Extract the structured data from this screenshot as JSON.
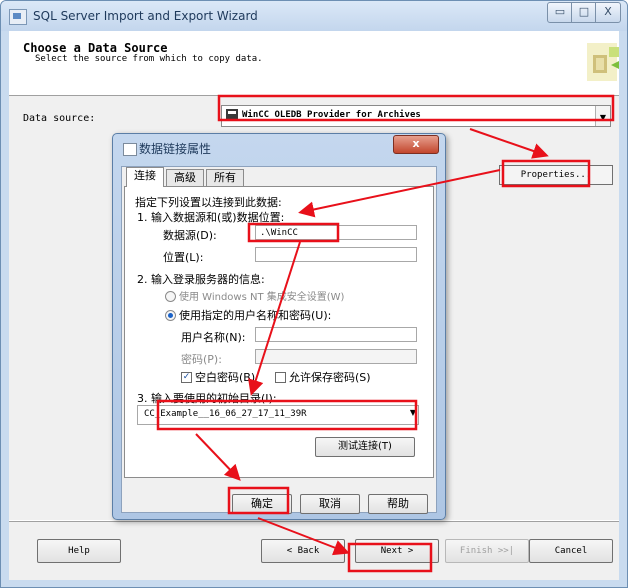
{
  "window": {
    "title": "SQL Server Import and Export Wizard",
    "minimize_glyph": "▭",
    "maximize_glyph": "□",
    "close_glyph": "X"
  },
  "header": {
    "title": "Choose a Data Source",
    "subtitle": "Select the source from which to copy data."
  },
  "main": {
    "data_source_label": "Data source:",
    "data_source_value": "WinCC OLEDB Provider for Archives",
    "properties_label": "Properties..."
  },
  "footer": {
    "help": "Help",
    "back": "< Back",
    "next": "Next >",
    "finish": "Finish >>|",
    "cancel": "Cancel"
  },
  "dialog": {
    "title": "数据链接属性",
    "close_label": "x",
    "tabs": [
      "连接",
      "高级",
      "所有"
    ],
    "intro": "指定下列设置以连接到此数据:",
    "step1": "1. 输入数据源和(或)数据位置:",
    "datasource_label": "数据源(D):",
    "datasource_value": ".\\WinCC",
    "location_label": "位置(L):",
    "location_value": "",
    "step2": "2. 输入登录服务器的信息:",
    "radio_windows": "使用 Windows NT 集成安全设置(W)",
    "radio_specific": "使用指定的用户名称和密码(U):",
    "username_label": "用户名称(N):",
    "password_label": "密码(P):",
    "blank_password_label": "空白密码(B)",
    "allow_save_label": "允许保存密码(S)",
    "step3": "3. 输入要使用的初始目录(I):",
    "catalog_value": "CC_Example__16_06_27_17_11_39R",
    "test_label": "测试连接(T)",
    "ok": "确定",
    "cancel": "取消",
    "help": "帮助"
  },
  "colors": {
    "annotation_red": "#e8101a",
    "window_frame": "#c9dbef",
    "dialog_frame": "#aec6e4"
  },
  "icons": {
    "app": "wizard-app-icon",
    "dialog": "datalink-icon",
    "provider": "provider-icon",
    "dropdown": "chevron-down-icon"
  }
}
